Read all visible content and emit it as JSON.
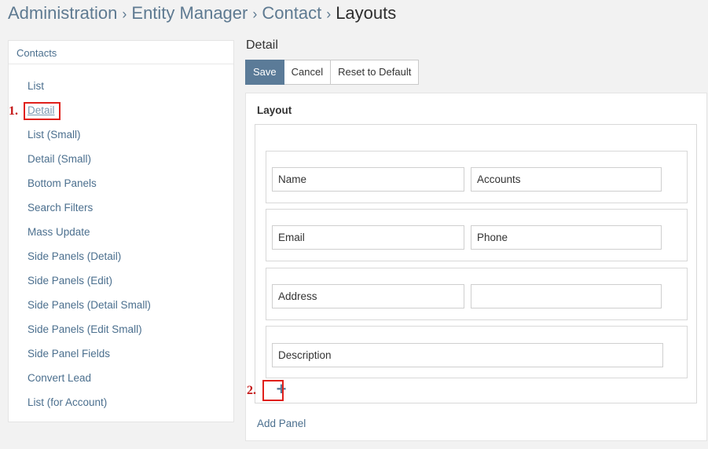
{
  "breadcrumb": {
    "items": [
      "Administration",
      "Entity Manager",
      "Contact"
    ],
    "current": "Layouts",
    "separator": "›"
  },
  "sidebar": {
    "header": "Contacts",
    "items": [
      {
        "label": "List"
      },
      {
        "label": "Detail",
        "active": true
      },
      {
        "label": "List (Small)"
      },
      {
        "label": "Detail (Small)"
      },
      {
        "label": "Bottom Panels"
      },
      {
        "label": "Search Filters"
      },
      {
        "label": "Mass Update"
      },
      {
        "label": "Side Panels (Detail)"
      },
      {
        "label": "Side Panels (Edit)"
      },
      {
        "label": "Side Panels (Detail Small)"
      },
      {
        "label": "Side Panels (Edit Small)"
      },
      {
        "label": "Side Panel Fields"
      },
      {
        "label": "Convert Lead"
      },
      {
        "label": "List (for Account)"
      }
    ]
  },
  "annotations": {
    "marker1": "1.",
    "marker2": "2."
  },
  "main": {
    "title": "Detail",
    "buttons": {
      "save": "Save",
      "cancel": "Cancel",
      "reset": "Reset to Default"
    },
    "layout": {
      "title": "Layout",
      "panels": [
        {
          "fields": [
            "Name",
            "Accounts"
          ]
        },
        {
          "fields": [
            "Email",
            "Phone"
          ]
        },
        {
          "fields": [
            "Address",
            ""
          ]
        },
        {
          "fields": [
            "Description"
          ]
        }
      ],
      "add_row_icon": "+",
      "add_panel": "Add Panel"
    }
  },
  "colors": {
    "accent": "#5b7b98",
    "link": "#4b6f8e",
    "annotation": "#e0201b"
  }
}
